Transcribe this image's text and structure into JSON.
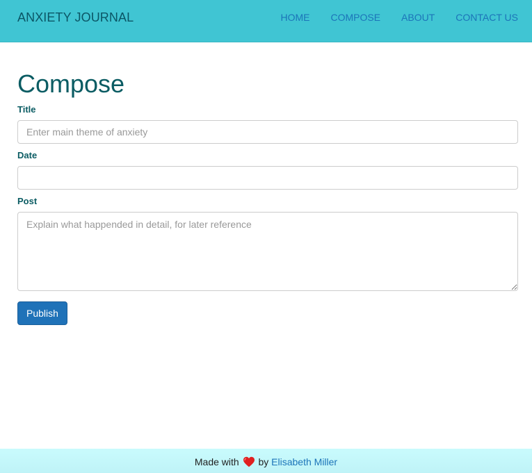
{
  "navbar": {
    "brand": "ANXIETY JOURNAL",
    "links": [
      {
        "label": "HOME"
      },
      {
        "label": "COMPOSE"
      },
      {
        "label": "ABOUT"
      },
      {
        "label": "CONTACT US"
      }
    ]
  },
  "compose": {
    "title": "Compose",
    "title_field": {
      "label": "Title",
      "placeholder": "Enter main theme of anxiety",
      "value": ""
    },
    "date_field": {
      "label": "Date",
      "placeholder": "",
      "value": ""
    },
    "post_field": {
      "label": "Post",
      "placeholder": "Explain what happended in detail, for later reference",
      "value": ""
    },
    "publish_label": "Publish"
  },
  "footer": {
    "prefix": "Made with",
    "icon": "heart-icon",
    "by": "by",
    "author": "Elisabeth Miller"
  },
  "colors": {
    "navbar_bg": "#40c5d3",
    "accent": "#1f72b8",
    "heading": "#0b5c63",
    "footer_bg": "#c9fbfd",
    "heart": "#e02020"
  }
}
